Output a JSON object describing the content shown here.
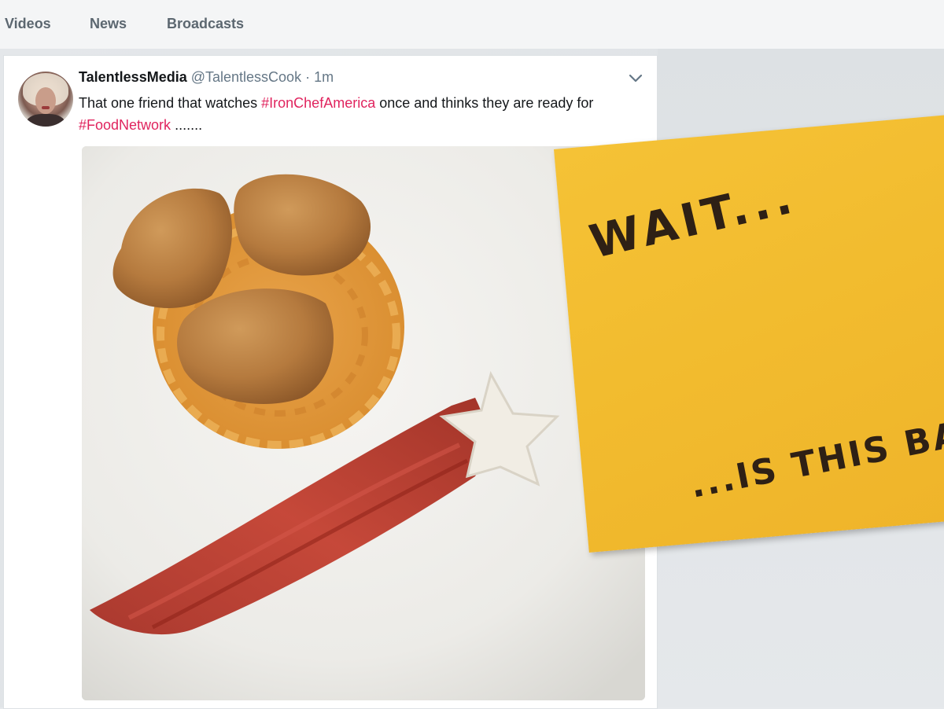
{
  "nav": {
    "tabs": [
      {
        "label": "Videos"
      },
      {
        "label": "News"
      },
      {
        "label": "Broadcasts"
      }
    ]
  },
  "tweet": {
    "display_name": "TalentlessMedia",
    "handle": "@TalentlessCook",
    "separator": "·",
    "time": "1m",
    "text_part1": "That one friend that watches ",
    "hashtag1": "#IronChefAmerica",
    "text_part2": " once and thinks they are ready for ",
    "hashtag2": "#FoodNetwork",
    "text_part3": " .......",
    "hashtag_color": "#e0245e",
    "menu_icon": "chevron-down-icon",
    "avatar_icon": "user-avatar"
  },
  "sticky_note": {
    "line1": "WAIT...",
    "line2": "...IS THIS BAD?",
    "color": "#f2bc2f"
  }
}
